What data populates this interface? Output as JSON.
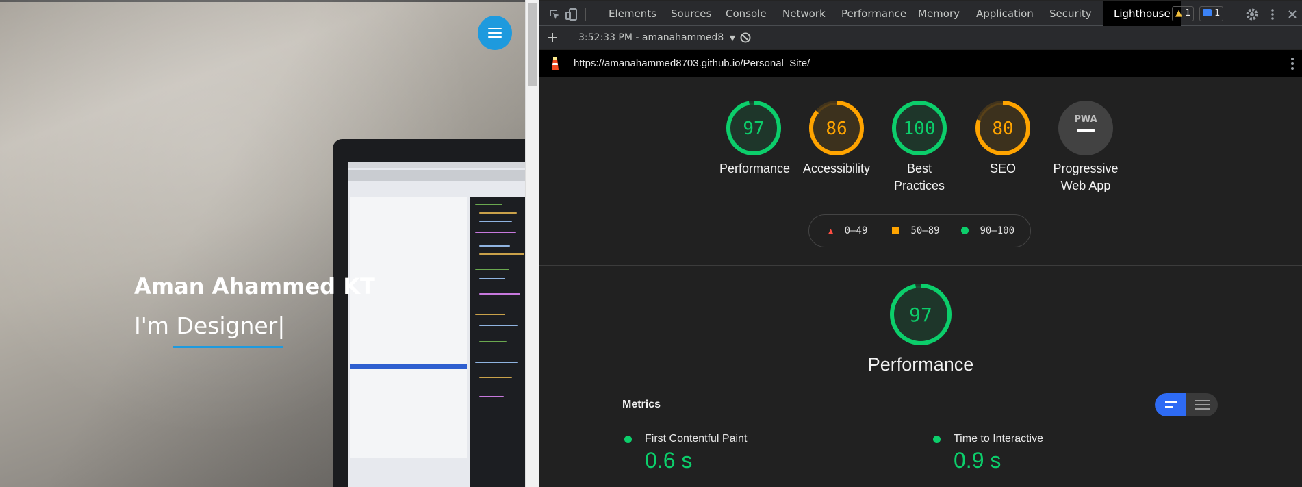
{
  "site": {
    "hero_name": "Aman Ahammed KT",
    "hero_role": "I'm Designer|"
  },
  "devtools": {
    "tabs": [
      {
        "label": "Elements"
      },
      {
        "label": "Sources"
      },
      {
        "label": "Console"
      },
      {
        "label": "Network"
      },
      {
        "label": "Performance"
      },
      {
        "label": "Memory"
      },
      {
        "label": "Application"
      },
      {
        "label": "Security"
      },
      {
        "label": "Lighthouse"
      }
    ],
    "warnings_count": "1",
    "messages_count": "1",
    "report_selector": "3:52:33 PM - amanahammed8",
    "report_url": "https://amanahammed8703.github.io/Personal_Site/"
  },
  "lighthouse": {
    "scores": [
      {
        "label": "Performance",
        "value": 97,
        "status": "pass"
      },
      {
        "label": "Accessibility",
        "value": 86,
        "status": "average"
      },
      {
        "label": "Best Practices",
        "value": 100,
        "status": "pass"
      },
      {
        "label": "SEO",
        "value": 80,
        "status": "average"
      }
    ],
    "pwa": {
      "label": "Progressive Web App",
      "badge": "PWA"
    },
    "legend": [
      {
        "range": "0–49",
        "color": "#ff4e42"
      },
      {
        "range": "50–89",
        "color": "#ffa400"
      },
      {
        "range": "90–100",
        "color": "#0cce6b"
      }
    ],
    "category": {
      "title": "Performance",
      "score": 97
    },
    "metrics_title": "Metrics",
    "metrics": [
      {
        "name": "First Contentful Paint",
        "value": "0.6 s",
        "status": "pass"
      },
      {
        "name": "Time to Interactive",
        "value": "0.9 s",
        "status": "pass"
      }
    ]
  },
  "colors": {
    "pass": "#0cce6b",
    "average": "#ffa400",
    "fail": "#ff4e42",
    "accent": "#1e9ade"
  }
}
